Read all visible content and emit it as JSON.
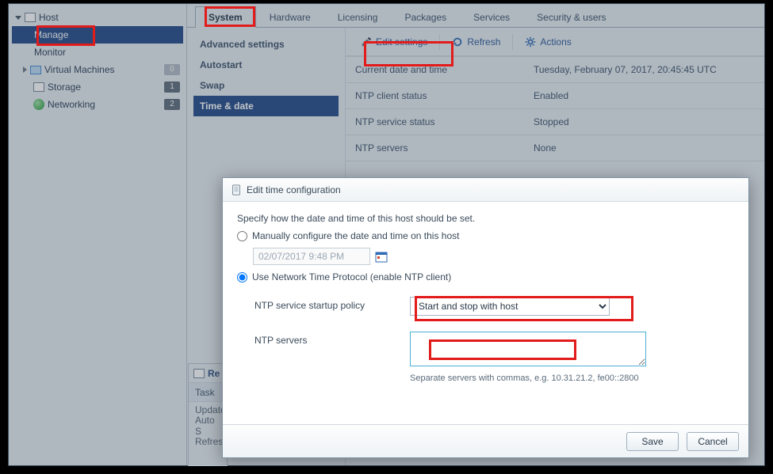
{
  "sidebar": {
    "host": "Host",
    "manage": "Manage",
    "monitor": "Monitor",
    "vm": {
      "label": "Virtual Machines",
      "badge": "0"
    },
    "storage": {
      "label": "Storage",
      "badge": "1"
    },
    "networking": {
      "label": "Networking",
      "badge": "2"
    }
  },
  "tabs": [
    "System",
    "Hardware",
    "Licensing",
    "Packages",
    "Services",
    "Security & users"
  ],
  "subnav": [
    "Advanced settings",
    "Autostart",
    "Swap",
    "Time & date"
  ],
  "toolbar": {
    "edit": "Edit settings",
    "refresh": "Refresh",
    "actions": "Actions"
  },
  "kv": [
    {
      "k": "Current date and time",
      "v": "Tuesday, February 07, 2017, 20:45:45 UTC"
    },
    {
      "k": "NTP client status",
      "v": "Enabled"
    },
    {
      "k": "NTP service status",
      "v": "Stopped"
    },
    {
      "k": "NTP servers",
      "v": "None"
    }
  ],
  "tasks": {
    "header": "Re",
    "col": "Task",
    "rows": [
      "Update",
      "Auto S",
      "Refres"
    ]
  },
  "dialog": {
    "title": "Edit time configuration",
    "desc": "Specify how the date and time of this host should be set.",
    "opt_manual": "Manually configure the date and time on this host",
    "date_value": "02/07/2017 9:48 PM",
    "opt_ntp": "Use Network Time Protocol (enable NTP client)",
    "policy_label": "NTP service startup policy",
    "policy_value": "Start and stop with host",
    "servers_label": "NTP servers",
    "servers_hint": "Separate servers with commas, e.g. 10.31.21.2, fe00::2800",
    "save": "Save",
    "cancel": "Cancel"
  }
}
